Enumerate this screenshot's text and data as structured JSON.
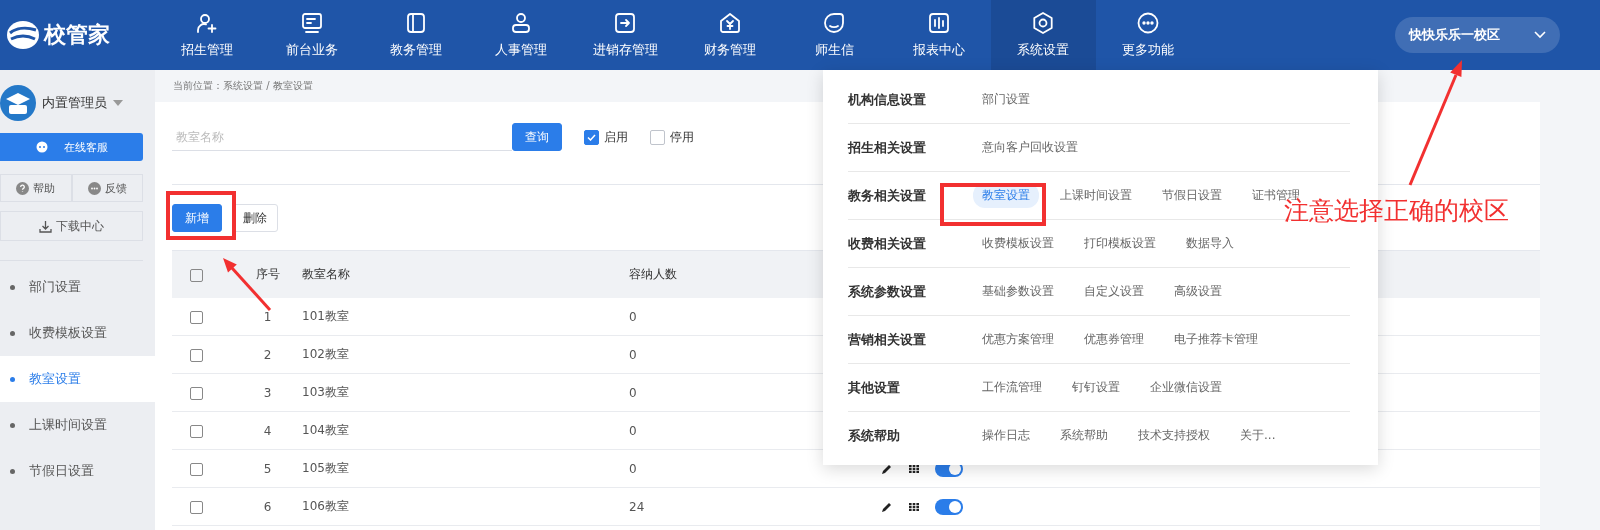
{
  "logo": {
    "text": "校管家"
  },
  "nav": [
    {
      "label": "招生管理",
      "selected": false
    },
    {
      "label": "前台业务",
      "selected": false
    },
    {
      "label": "教务管理",
      "selected": false
    },
    {
      "label": "人事管理",
      "selected": false
    },
    {
      "label": "进销存管理",
      "selected": false
    },
    {
      "label": "财务管理",
      "selected": false
    },
    {
      "label": "师生信",
      "selected": false
    },
    {
      "label": "报表中心",
      "selected": false
    },
    {
      "label": "系统设置",
      "selected": true
    },
    {
      "label": "更多功能",
      "selected": false
    }
  ],
  "campus": {
    "label": "快快乐乐一校区"
  },
  "sidebar": {
    "user": "内置管理员",
    "service_button": "在线客服",
    "help": "帮助",
    "feedback": "反馈",
    "download": "下载中心",
    "items": [
      {
        "label": "部门设置",
        "selected": false
      },
      {
        "label": "收费模板设置",
        "selected": false
      },
      {
        "label": "教室设置",
        "selected": true
      },
      {
        "label": "上课时间设置",
        "selected": false
      },
      {
        "label": "节假日设置",
        "selected": false
      }
    ]
  },
  "breadcrumb": "当前位置：系统设置 / 教室设置",
  "search": {
    "placeholder": "教室名称",
    "button": "查询",
    "filters": [
      {
        "label": "启用",
        "checked": true
      },
      {
        "label": "停用",
        "checked": false
      }
    ]
  },
  "actions": [
    {
      "label": "新增",
      "kind": "primary"
    },
    {
      "label": "删除",
      "kind": "default"
    }
  ],
  "table": {
    "all_checked": false,
    "columns": [
      "序号",
      "教室名称",
      "容纳人数"
    ],
    "rows": [
      {
        "checked": false,
        "index": "1",
        "name": "101教室",
        "capacity": "0"
      },
      {
        "checked": false,
        "index": "2",
        "name": "102教室",
        "capacity": "0"
      },
      {
        "checked": false,
        "index": "3",
        "name": "103教室",
        "capacity": "0"
      },
      {
        "checked": false,
        "index": "4",
        "name": "104教室",
        "capacity": "0"
      },
      {
        "checked": false,
        "index": "5",
        "name": "105教室",
        "capacity": "0",
        "enabled": true
      },
      {
        "checked": false,
        "index": "6",
        "name": "106教室",
        "capacity": "24",
        "enabled": true
      }
    ]
  },
  "settings_menu": {
    "groups": [
      {
        "label": "机构信息设置",
        "items": [
          {
            "label": "部门设置",
            "selected": false
          }
        ]
      },
      {
        "label": "招生相关设置",
        "items": [
          {
            "label": "意向客户回收设置",
            "selected": false
          }
        ]
      },
      {
        "label": "教务相关设置",
        "items": [
          {
            "label": "教室设置",
            "selected": true
          },
          {
            "label": "上课时间设置",
            "selected": false
          },
          {
            "label": "节假日设置",
            "selected": false
          },
          {
            "label": "证书管理",
            "selected": false
          }
        ]
      },
      {
        "label": "收费相关设置",
        "items": [
          {
            "label": "收费模板设置",
            "selected": false
          },
          {
            "label": "打印模板设置",
            "selected": false
          },
          {
            "label": "数据导入",
            "selected": false
          }
        ]
      },
      {
        "label": "系统参数设置",
        "items": [
          {
            "label": "基础参数设置",
            "selected": false
          },
          {
            "label": "自定义设置",
            "selected": false
          },
          {
            "label": "高级设置",
            "selected": false
          }
        ]
      },
      {
        "label": "营销相关设置",
        "items": [
          {
            "label": "优惠方案管理",
            "selected": false
          },
          {
            "label": "优惠券管理",
            "selected": false
          },
          {
            "label": "电子推荐卡管理",
            "selected": false
          }
        ]
      },
      {
        "label": "其他设置",
        "items": [
          {
            "label": "工作流管理",
            "selected": false
          },
          {
            "label": "钉钉设置",
            "selected": false
          },
          {
            "label": "企业微信设置",
            "selected": false
          }
        ]
      },
      {
        "label": "系统帮助",
        "items": [
          {
            "label": "操作日志",
            "selected": false
          },
          {
            "label": "系统帮助",
            "selected": false
          },
          {
            "label": "技术支持授权",
            "selected": false
          },
          {
            "label": "关于...",
            "selected": false
          }
        ]
      }
    ]
  },
  "annotation": {
    "text": "注意选择正确的校区"
  }
}
